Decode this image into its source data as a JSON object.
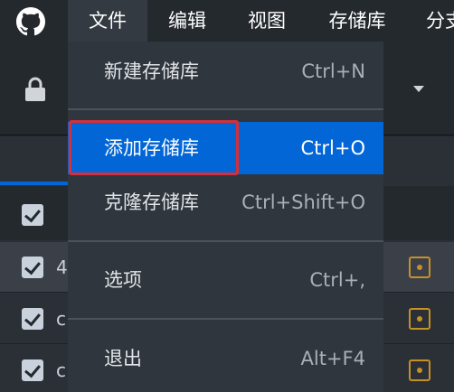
{
  "colors": {
    "titlebar_bg": "#24292e",
    "menu_bg": "#2f363d",
    "highlight": "#0366d6",
    "annotation": "#d32f3c",
    "modified_icon": "#c69026"
  },
  "titlebar": {
    "logo_icon": "github-icon",
    "menus": [
      {
        "label": "文件"
      },
      {
        "label": "编辑"
      },
      {
        "label": "视图"
      },
      {
        "label": "存储库"
      },
      {
        "label": "分支"
      }
    ]
  },
  "file_menu": {
    "items": [
      {
        "label": "新建存储库",
        "shortcut": "Ctrl+N"
      },
      {
        "label": "添加存储库",
        "shortcut": "Ctrl+O"
      },
      {
        "label": "克隆存储库",
        "shortcut": "Ctrl+Shift+O"
      },
      {
        "label": "选项",
        "shortcut": "Ctrl+,"
      },
      {
        "label": "退出",
        "shortcut": "Alt+F4"
      }
    ]
  },
  "changes": {
    "rows": [
      {
        "text": "4"
      },
      {
        "text": "c"
      },
      {
        "text": "c"
      }
    ]
  }
}
